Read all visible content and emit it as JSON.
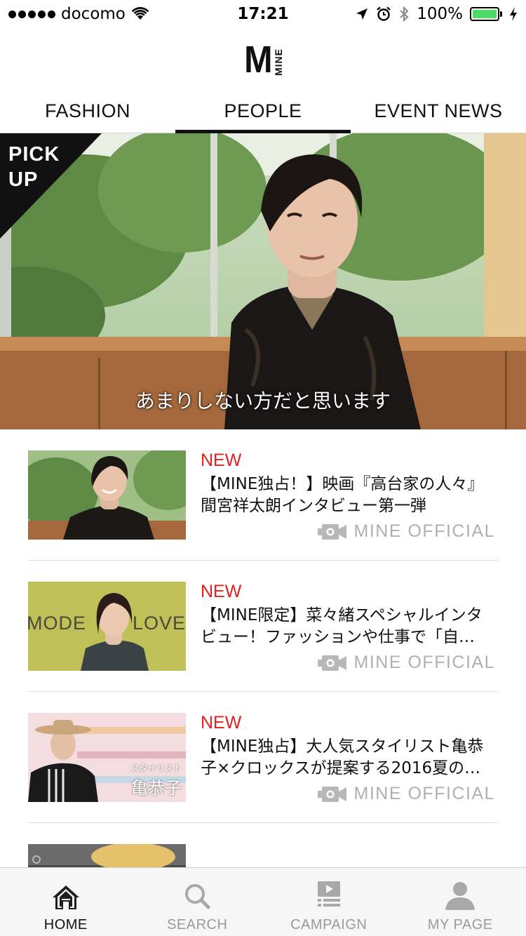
{
  "status_bar": {
    "carrier": "docomo",
    "time": "17:21",
    "battery": "100%",
    "battery_color": "#4cd964"
  },
  "header": {
    "logo_mark": "M",
    "logo_sub": "MINE"
  },
  "tabs": [
    {
      "label": "FASHION",
      "active": false
    },
    {
      "label": "PEOPLE",
      "active": true
    },
    {
      "label": "EVENT NEWS",
      "active": false
    }
  ],
  "hero": {
    "badge_line1": "PICK",
    "badge_line2": "UP",
    "caption": "あまりしない方だと思います"
  },
  "articles": [
    {
      "badge": "NEW",
      "title": "【MINE独占！】映画『高台家の人々』間宮祥太朗インタビュー第一弾",
      "source": "MINE OFFICIAL",
      "source_icon": "video-camera-icon"
    },
    {
      "badge": "NEW",
      "title": "【MINE限定】菜々緒スペシャルインタビュー！ファッションや仕事で「自…",
      "source": "MINE OFFICIAL",
      "source_icon": "video-camera-icon",
      "thumb_text_left": "MODE",
      "thumb_text_right": "LOVE"
    },
    {
      "badge": "NEW",
      "title": "【MINE独占】大人気スタイリスト亀恭子×クロックスが提案する2016夏の…",
      "source": "MINE OFFICIAL",
      "source_icon": "video-camera-icon",
      "thumb_small": "スタイリスト",
      "thumb_name": "亀恭子"
    }
  ],
  "bottom_nav": [
    {
      "label": "HOME",
      "icon": "home-icon",
      "active": true
    },
    {
      "label": "SEARCH",
      "icon": "search-icon",
      "active": false
    },
    {
      "label": "CAMPAIGN",
      "icon": "campaign-icon",
      "active": false
    },
    {
      "label": "MY PAGE",
      "icon": "user-icon",
      "active": false
    }
  ],
  "colors": {
    "accent_new": "#e02020",
    "active_text": "#111111",
    "inactive_text": "#9a9a9a"
  }
}
